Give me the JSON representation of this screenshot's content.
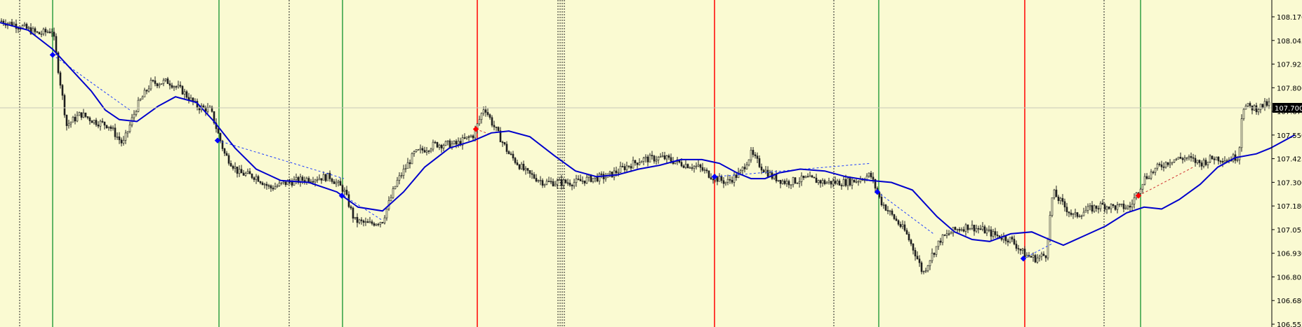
{
  "chart_data": {
    "type": "line",
    "title": "",
    "xlabel": "",
    "ylabel": "",
    "ylim": [
      106.555,
      108.2
    ],
    "y_ticks": [
      "108.170",
      "108.045",
      "107.925",
      "107.800",
      "107.675",
      "107.550",
      "107.425",
      "107.300",
      "107.180",
      "107.055",
      "106.930",
      "106.805",
      "106.680",
      "106.555"
    ],
    "current_price": "107.700",
    "grid": false,
    "colors": {
      "background": "#fafad2",
      "candle": "#1f1f1f",
      "moving_average": "#0000cc",
      "dashed_trend": "#1f3fff",
      "dashed_trend_red": "#d03030",
      "vline_green": "#2ea043",
      "vline_red": "#ff0000",
      "vline_dotted": "#222222",
      "price_tag": "#000000"
    },
    "icons": [
      "price-tag-icon"
    ],
    "moving_average": [
      [
        0,
        108.14
      ],
      [
        40,
        108.1
      ],
      [
        75,
        108.0
      ],
      [
        100,
        107.9
      ],
      [
        130,
        107.78
      ],
      [
        150,
        107.68
      ],
      [
        170,
        107.63
      ],
      [
        195,
        107.62
      ],
      [
        225,
        107.7
      ],
      [
        250,
        107.75
      ],
      [
        280,
        107.72
      ],
      [
        305,
        107.62
      ],
      [
        335,
        107.48
      ],
      [
        365,
        107.37
      ],
      [
        400,
        107.31
      ],
      [
        440,
        107.3
      ],
      [
        480,
        107.25
      ],
      [
        510,
        107.17
      ],
      [
        545,
        107.15
      ],
      [
        575,
        107.25
      ],
      [
        605,
        107.38
      ],
      [
        640,
        107.48
      ],
      [
        675,
        107.52
      ],
      [
        700,
        107.56
      ],
      [
        725,
        107.57
      ],
      [
        755,
        107.54
      ],
      [
        790,
        107.44
      ],
      [
        820,
        107.36
      ],
      [
        850,
        107.33
      ],
      [
        880,
        107.34
      ],
      [
        910,
        107.37
      ],
      [
        940,
        107.39
      ],
      [
        970,
        107.42
      ],
      [
        1000,
        107.42
      ],
      [
        1025,
        107.4
      ],
      [
        1050,
        107.35
      ],
      [
        1070,
        107.32
      ],
      [
        1090,
        107.32
      ],
      [
        1110,
        107.35
      ],
      [
        1140,
        107.37
      ],
      [
        1175,
        107.36
      ],
      [
        1205,
        107.33
      ],
      [
        1240,
        107.31
      ],
      [
        1270,
        107.3
      ],
      [
        1300,
        107.26
      ],
      [
        1335,
        107.12
      ],
      [
        1360,
        107.04
      ],
      [
        1385,
        107.0
      ],
      [
        1410,
        106.99
      ],
      [
        1440,
        107.03
      ],
      [
        1470,
        107.04
      ],
      [
        1495,
        107.0
      ],
      [
        1515,
        106.97
      ],
      [
        1545,
        107.02
      ],
      [
        1575,
        107.07
      ],
      [
        1605,
        107.14
      ],
      [
        1630,
        107.17
      ],
      [
        1655,
        107.16
      ],
      [
        1680,
        107.21
      ],
      [
        1710,
        107.29
      ],
      [
        1735,
        107.38
      ],
      [
        1760,
        107.43
      ],
      [
        1790,
        107.45
      ],
      [
        1810,
        107.48
      ],
      [
        1830,
        107.52
      ],
      [
        1845,
        107.55
      ]
    ],
    "trend_lines": [
      {
        "color": "blue",
        "points": [
          [
            75,
            107.97
          ],
          [
            185,
            107.68
          ]
        ]
      },
      {
        "color": "blue",
        "points": [
          [
            310,
            107.52
          ],
          [
            490,
            107.32
          ]
        ]
      },
      {
        "color": "blue",
        "points": [
          [
            490,
            107.23
          ],
          [
            545,
            107.1
          ]
        ]
      },
      {
        "color": "red",
        "points": [
          [
            678,
            107.58
          ],
          [
            700,
            107.55
          ]
        ]
      },
      {
        "color": "blue",
        "points": [
          [
            1020,
            107.33
          ],
          [
            1240,
            107.4
          ]
        ]
      },
      {
        "color": "blue",
        "points": [
          [
            1250,
            107.25
          ],
          [
            1330,
            107.03
          ]
        ]
      },
      {
        "color": "blue",
        "points": [
          [
            1458,
            106.9
          ],
          [
            1500,
            106.98
          ]
        ]
      },
      {
        "color": "red",
        "points": [
          [
            1622,
            107.23
          ],
          [
            1700,
            107.38
          ]
        ]
      }
    ],
    "markers": [
      {
        "x": 75,
        "y": 107.97,
        "color": "blue"
      },
      {
        "x": 310,
        "y": 107.52,
        "color": "blue"
      },
      {
        "x": 487,
        "y": 107.23,
        "color": "blue"
      },
      {
        "x": 678,
        "y": 107.58,
        "color": "red"
      },
      {
        "x": 1018,
        "y": 107.33,
        "color": "blue"
      },
      {
        "x": 1250,
        "y": 107.25,
        "color": "blue"
      },
      {
        "x": 1458,
        "y": 106.9,
        "color": "blue"
      },
      {
        "x": 1622,
        "y": 107.23,
        "color": "red"
      }
    ],
    "vertical_lines": [
      {
        "x": 75,
        "style": "green"
      },
      {
        "x": 312,
        "style": "green"
      },
      {
        "x": 488,
        "style": "green"
      },
      {
        "x": 680,
        "style": "red"
      },
      {
        "x": 1018,
        "style": "red"
      },
      {
        "x": 1252,
        "style": "green"
      },
      {
        "x": 1460,
        "style": "red"
      },
      {
        "x": 1625,
        "style": "green"
      },
      {
        "x": 28,
        "style": "dotted"
      },
      {
        "x": 412,
        "style": "dotted"
      },
      {
        "x": 795,
        "style": "dotted"
      },
      {
        "x": 798,
        "style": "dotted"
      },
      {
        "x": 801,
        "style": "dotted"
      },
      {
        "x": 804,
        "style": "dotted"
      },
      {
        "x": 1188,
        "style": "dotted"
      },
      {
        "x": 1573,
        "style": "dotted"
      }
    ],
    "price_anchors": [
      [
        0,
        108.15
      ],
      [
        30,
        108.12
      ],
      [
        55,
        108.08
      ],
      [
        75,
        108.1
      ],
      [
        82,
        107.92
      ],
      [
        95,
        107.6
      ],
      [
        115,
        107.66
      ],
      [
        135,
        107.62
      ],
      [
        155,
        107.6
      ],
      [
        175,
        107.5
      ],
      [
        195,
        107.7
      ],
      [
        215,
        107.82
      ],
      [
        240,
        107.83
      ],
      [
        260,
        107.78
      ],
      [
        280,
        107.7
      ],
      [
        300,
        107.68
      ],
      [
        320,
        107.45
      ],
      [
        340,
        107.35
      ],
      [
        365,
        107.33
      ],
      [
        385,
        107.27
      ],
      [
        410,
        107.3
      ],
      [
        440,
        107.32
      ],
      [
        470,
        107.33
      ],
      [
        490,
        107.26
      ],
      [
        505,
        107.1
      ],
      [
        525,
        107.08
      ],
      [
        545,
        107.1
      ],
      [
        565,
        107.3
      ],
      [
        590,
        107.45
      ],
      [
        620,
        107.5
      ],
      [
        650,
        107.5
      ],
      [
        675,
        107.55
      ],
      [
        690,
        107.7
      ],
      [
        700,
        107.62
      ],
      [
        725,
        107.45
      ],
      [
        750,
        107.35
      ],
      [
        775,
        107.3
      ],
      [
        800,
        107.3
      ],
      [
        820,
        107.3
      ],
      [
        840,
        107.32
      ],
      [
        865,
        107.33
      ],
      [
        890,
        107.38
      ],
      [
        915,
        107.42
      ],
      [
        945,
        107.43
      ],
      [
        970,
        107.4
      ],
      [
        995,
        107.38
      ],
      [
        1015,
        107.33
      ],
      [
        1035,
        107.3
      ],
      [
        1055,
        107.35
      ],
      [
        1070,
        107.45
      ],
      [
        1085,
        107.38
      ],
      [
        1100,
        107.33
      ],
      [
        1120,
        107.3
      ],
      [
        1150,
        107.32
      ],
      [
        1175,
        107.3
      ],
      [
        1200,
        107.3
      ],
      [
        1220,
        107.31
      ],
      [
        1240,
        107.34
      ],
      [
        1255,
        107.2
      ],
      [
        1270,
        107.13
      ],
      [
        1290,
        107.04
      ],
      [
        1305,
        106.92
      ],
      [
        1315,
        106.82
      ],
      [
        1325,
        106.9
      ],
      [
        1340,
        107.0
      ],
      [
        1360,
        107.05
      ],
      [
        1380,
        107.07
      ],
      [
        1400,
        107.05
      ],
      [
        1420,
        107.02
      ],
      [
        1440,
        107.0
      ],
      [
        1460,
        106.92
      ],
      [
        1475,
        106.9
      ],
      [
        1490,
        106.92
      ],
      [
        1500,
        107.25
      ],
      [
        1515,
        107.18
      ],
      [
        1530,
        107.12
      ],
      [
        1545,
        107.15
      ],
      [
        1570,
        107.18
      ],
      [
        1590,
        107.17
      ],
      [
        1610,
        107.17
      ],
      [
        1630,
        107.32
      ],
      [
        1650,
        107.38
      ],
      [
        1670,
        107.42
      ],
      [
        1690,
        107.43
      ],
      [
        1710,
        107.4
      ],
      [
        1730,
        107.43
      ],
      [
        1750,
        107.42
      ],
      [
        1765,
        107.44
      ],
      [
        1770,
        107.7
      ],
      [
        1790,
        107.69
      ],
      [
        1805,
        107.71
      ],
      [
        1815,
        107.71
      ]
    ]
  }
}
